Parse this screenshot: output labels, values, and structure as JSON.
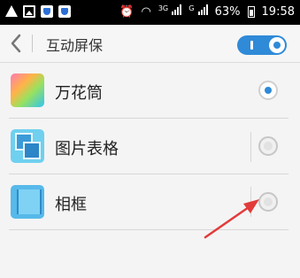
{
  "status_bar": {
    "network": "3G",
    "signal_small": "G",
    "battery_percent": "63%",
    "time": "19:58"
  },
  "header": {
    "title": "互动屏保",
    "toggle_on": true
  },
  "options": [
    {
      "label": "万花筒",
      "selected": true,
      "thumb_icon": "kaleidoscope-icon"
    },
    {
      "label": "图片表格",
      "selected": false,
      "thumb_icon": "picture-grid-icon"
    },
    {
      "label": "相框",
      "selected": false,
      "thumb_icon": "photo-frame-icon"
    }
  ],
  "colors": {
    "accent": "#2f8ad8",
    "annotation_arrow": "#e23b3b"
  }
}
